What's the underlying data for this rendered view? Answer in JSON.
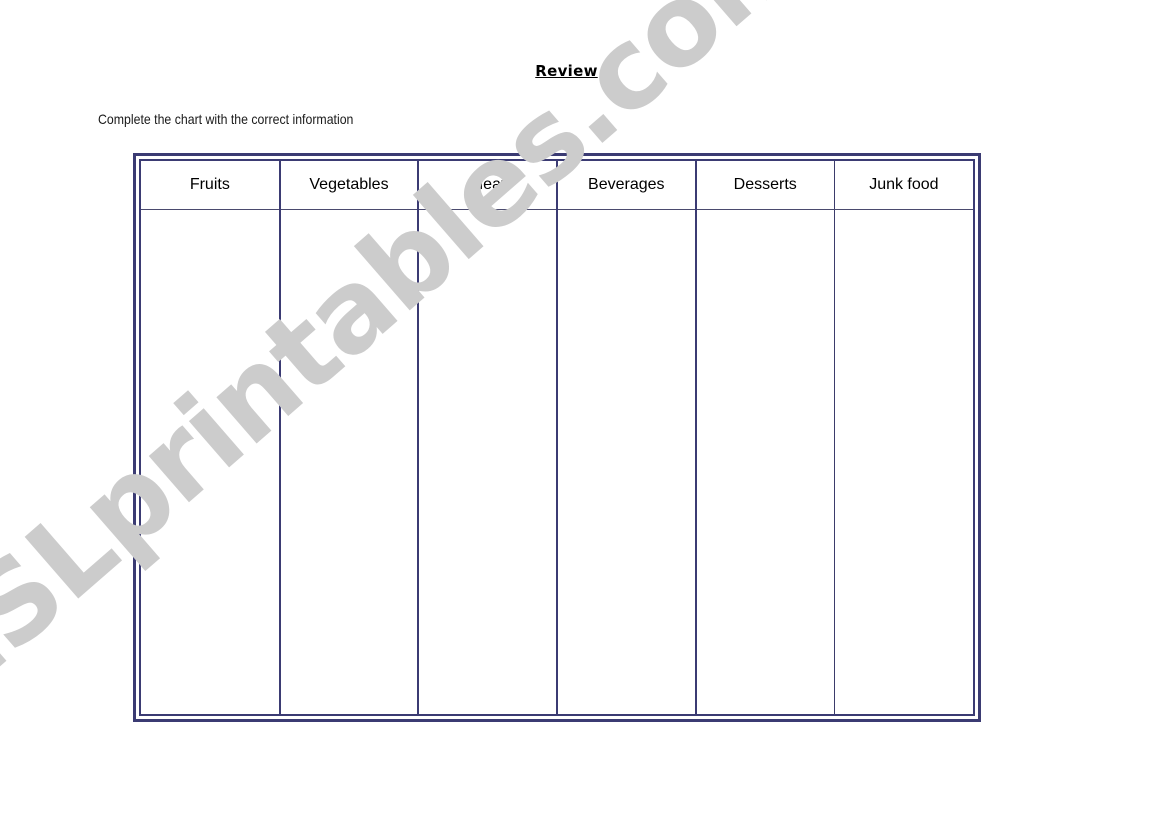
{
  "page": {
    "title": "Review",
    "instruction": "Complete the chart with the correct information",
    "watermark": "ESLprintables.com",
    "colors": {
      "frame_border": "#3b3b73",
      "header_rule": "#4a4a6e",
      "watermark": "#cccccc",
      "text": "#000000",
      "background": "#ffffff"
    }
  },
  "chart_data": {
    "type": "table",
    "title": "Review",
    "columns": [
      {
        "label": "Fruits",
        "divider": "thick"
      },
      {
        "label": "Vegetables",
        "divider": "thick"
      },
      {
        "label": "Meat",
        "divider": "thick"
      },
      {
        "label": "Beverages",
        "divider": "thick"
      },
      {
        "label": "Desserts",
        "divider": "thin"
      },
      {
        "label": "Junk food",
        "divider": "none"
      }
    ],
    "rows": [
      [
        "",
        "",
        "",
        "",
        "",
        ""
      ]
    ],
    "row_count": 1,
    "column_count": 6
  }
}
